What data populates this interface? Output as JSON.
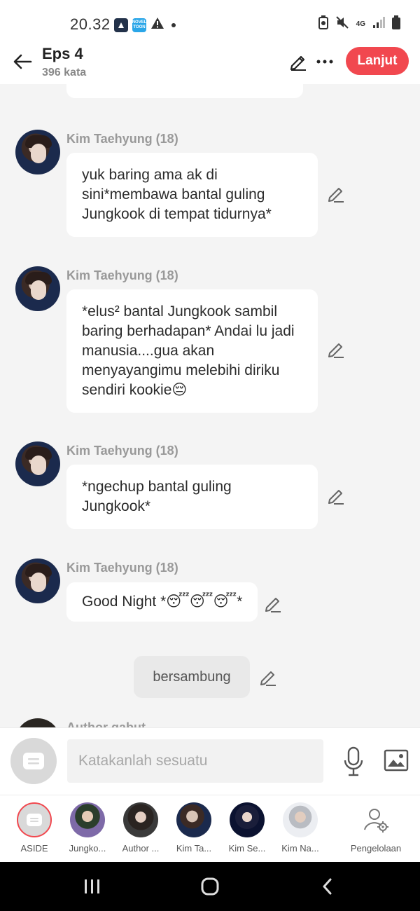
{
  "status_bar": {
    "time": "20.32",
    "network": "4G",
    "novel_icon_text": "NOVEL TOON"
  },
  "header": {
    "title": "Eps 4",
    "subtitle": "396 kata",
    "next_label": "Lanjut",
    "accent": "#f1484f"
  },
  "messages": [
    {
      "sender": "Kim Taehyung (18)",
      "text": "yuk baring ama ak di sini*membawa bantal guling Jungkook di tempat tidurnya*"
    },
    {
      "sender": "Kim Taehyung (18)",
      "text": "*elus² bantal Jungkook sambil baring berhadapan* Andai lu jadi manusia....gua akan menyayangimu melebihi diriku sendiri kookie😔"
    },
    {
      "sender": "Kim Taehyung (18)",
      "text": "*ngechup bantal guling Jungkook*"
    },
    {
      "sender": "Kim Taehyung (18)",
      "text": "Good Night *😴😴😴*"
    }
  ],
  "narration": {
    "text": "bersambung"
  },
  "partial_sender": "Author gabut",
  "composer": {
    "placeholder": "Katakanlah sesuatu"
  },
  "characters": [
    {
      "label": "ASIDE",
      "icon": "aside-icon"
    },
    {
      "label": "Jungko...",
      "icon": "avatar"
    },
    {
      "label": "Author ...",
      "icon": "avatar"
    },
    {
      "label": "Kim Ta...",
      "icon": "avatar"
    },
    {
      "label": "Kim Se...",
      "icon": "avatar"
    },
    {
      "label": "Kim Na...",
      "icon": "avatar"
    },
    {
      "label": "Pengelolaan",
      "icon": "user-gear-icon"
    }
  ],
  "icons": {
    "back": "arrow-left-icon",
    "edit": "pencil-icon",
    "more": "more-icon",
    "mic": "microphone-icon",
    "image": "image-icon"
  }
}
